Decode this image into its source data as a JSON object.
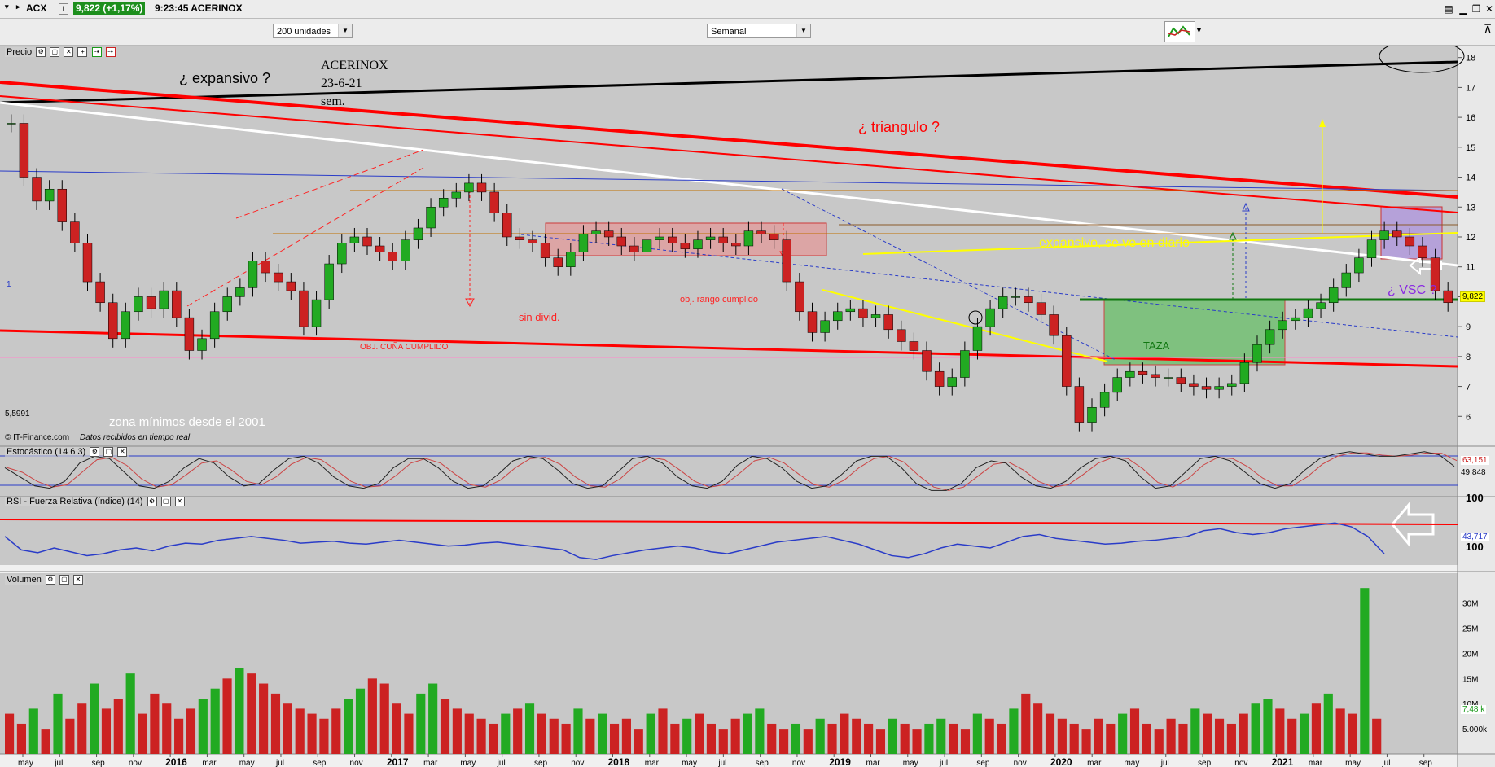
{
  "topbar": {
    "symbol": "ACX",
    "price_change": "9,822 (+1,17%)",
    "time_name": "9:23:45 ACERINOX"
  },
  "toolbar": {
    "units_select": "200 unidades",
    "period_select": "Semanal"
  },
  "panels": {
    "price": "Precio",
    "stochastic": "Estocástico (14 6 3)",
    "rsi": "RSI - Fuerza Relativa (índice) (14)",
    "volume": "Volumen"
  },
  "annotations": {
    "expansivo": "¿ expansivo ?",
    "title1": "ACERINOX",
    "title2": "23-6-21",
    "title3": "sem.",
    "triangulo": "¿ triangulo ?",
    "expansivo_diario": "expansivo, se ve en diario",
    "vsc": "¿ VSC ?",
    "sin_divid": "sin divid.",
    "obj_rango": "obj. rango cumplido",
    "obj_cuna": "OBJ. CUÑA CUMPLIDO",
    "taza": "TAZA",
    "zona_minimos": "zona mínimos desde el 2001",
    "min_label": "5,5991",
    "left_marker": "1",
    "source": "© IT-Finance.com",
    "source_note": "Datos recibidos en tiempo real",
    "price_tag": "9,822",
    "stoch_val1": "63,151",
    "stoch_val2": "49,848",
    "rsi_val": "43,717",
    "vol_val": "7,48 k"
  },
  "colors": {
    "background": "#c8c8c8",
    "up_candle": "#22aa22",
    "down_candle": "#cc2222",
    "red_line": "#ff0000",
    "white_line": "#ffffff",
    "blue_line": "#2a3cc8",
    "yellow_line": "#ffff00",
    "black_line": "#000000",
    "range_box": "#e0a0a0",
    "cup_box": "#6ec06e",
    "vsc_box": "#b39ddb"
  },
  "chart_data": [
    {
      "type": "line",
      "panel": "price",
      "title": "ACERINOX",
      "x_ticks": [
        "may",
        "jul",
        "sep",
        "nov",
        "2016",
        "mar",
        "may",
        "jul",
        "sep",
        "nov",
        "2017",
        "mar",
        "may",
        "jul",
        "sep",
        "nov",
        "2018",
        "mar",
        "may",
        "jul",
        "sep",
        "nov",
        "2019",
        "mar",
        "may",
        "jul",
        "sep",
        "nov",
        "2020",
        "mar",
        "may",
        "jul",
        "sep",
        "nov",
        "2021",
        "mar",
        "may",
        "jul",
        "sep"
      ],
      "y_ticks": [
        6,
        7,
        8,
        9,
        10,
        11,
        12,
        13,
        14,
        15,
        16,
        17,
        18
      ],
      "ylim": [
        5,
        18.4
      ],
      "series": [
        {
          "values": [
            15.8,
            14.0,
            13.2,
            13.6,
            12.5,
            11.8,
            10.5,
            9.8,
            8.6,
            9.5,
            10.0,
            9.6,
            10.2,
            9.3,
            8.2,
            8.6,
            9.5,
            10.0,
            10.3,
            11.2,
            10.8,
            10.5,
            10.2,
            9.0,
            9.9,
            11.1,
            11.8,
            12.0,
            11.7,
            11.5,
            11.2,
            11.9,
            12.3,
            13.0,
            13.3,
            13.5,
            13.8,
            13.5,
            12.8,
            12.0,
            11.9,
            11.8,
            11.3,
            11.0,
            11.5,
            12.1,
            12.2,
            12.0,
            11.7,
            11.5,
            11.9,
            12.0,
            11.8,
            11.6,
            11.9,
            12.0,
            11.8,
            11.7,
            12.2,
            12.1,
            11.9,
            10.5,
            9.5,
            8.8,
            9.2,
            9.5,
            9.6,
            9.3,
            9.4,
            8.9,
            8.5,
            8.2,
            7.5,
            7.0,
            7.3,
            8.2,
            9.0,
            9.6,
            10.0,
            10.0,
            9.8,
            9.4,
            8.7,
            7.0,
            5.8,
            6.3,
            6.8,
            7.3,
            7.5,
            7.4,
            7.3,
            7.3,
            7.1,
            7.0,
            6.9,
            7.0,
            7.1,
            7.8,
            8.4,
            8.9,
            9.2,
            9.3,
            9.6,
            9.8,
            10.3,
            10.8,
            11.3,
            11.9,
            12.2,
            12.0,
            11.7,
            11.3,
            10.2,
            9.8
          ]
        }
      ]
    },
    {
      "type": "line",
      "panel": "stochastic",
      "y_ticks": [
        100
      ],
      "ylim": [
        0,
        100
      ],
      "series": [
        {
          "values": [
            60,
            40,
            20,
            15,
            30,
            70,
            85,
            80,
            50,
            20,
            15,
            30,
            60,
            80,
            70,
            40,
            20,
            25,
            55,
            80,
            85,
            70,
            40,
            20,
            15,
            25,
            60,
            80,
            80,
            60,
            30,
            15,
            20,
            45,
            75,
            85,
            80,
            55,
            25,
            15,
            20,
            50,
            80,
            85,
            70,
            40,
            20,
            15,
            30,
            65,
            85,
            80,
            60,
            30,
            15,
            20,
            45,
            75,
            85,
            85,
            60,
            25,
            10,
            10,
            25,
            60,
            75,
            70,
            40,
            20,
            15,
            30,
            60,
            80,
            85,
            75,
            40,
            15,
            20,
            50,
            80,
            85,
            75,
            50,
            25,
            15,
            25,
            55,
            80,
            90,
            95,
            90,
            85,
            85,
            90,
            95,
            88,
            63
          ]
        }
      ]
    },
    {
      "type": "line",
      "panel": "rsi",
      "y_ticks": [
        100
      ],
      "ylim": [
        0,
        100
      ],
      "series": [
        {
          "values": [
            62,
            48,
            45,
            50,
            46,
            42,
            44,
            48,
            50,
            47,
            52,
            55,
            54,
            58,
            60,
            62,
            60,
            58,
            55,
            56,
            57,
            55,
            54,
            56,
            58,
            56,
            54,
            52,
            53,
            55,
            56,
            54,
            52,
            50,
            48,
            40,
            38,
            42,
            45,
            48,
            50,
            52,
            50,
            46,
            44,
            48,
            52,
            56,
            58,
            60,
            62,
            58,
            54,
            48,
            42,
            40,
            44,
            50,
            54,
            52,
            50,
            56,
            62,
            64,
            60,
            58,
            56,
            54,
            55,
            57,
            58,
            60,
            62,
            68,
            70,
            66,
            64,
            66,
            70,
            72,
            74,
            76,
            72,
            62,
            44
          ]
        }
      ]
    },
    {
      "type": "bar",
      "panel": "volume",
      "y_ticks": [
        "5.000k",
        "10M",
        "15M",
        "20M",
        "25M",
        "30M"
      ],
      "ylim": [
        0,
        34
      ],
      "values": [
        8,
        6,
        9,
        5,
        12,
        7,
        10,
        14,
        9,
        11,
        16,
        8,
        12,
        10,
        7,
        9,
        11,
        13,
        15,
        17,
        16,
        14,
        12,
        10,
        9,
        8,
        7,
        9,
        11,
        13,
        15,
        14,
        10,
        8,
        12,
        14,
        11,
        9,
        8,
        7,
        6,
        8,
        9,
        10,
        8,
        7,
        6,
        9,
        7,
        8,
        6,
        7,
        5,
        8,
        9,
        6,
        7,
        8,
        6,
        5,
        7,
        8,
        9,
        6,
        5,
        6,
        5,
        7,
        6,
        8,
        7,
        6,
        5,
        7,
        6,
        5,
        6,
        7,
        6,
        5,
        8,
        7,
        6,
        9,
        12,
        10,
        8,
        7,
        6,
        5,
        7,
        6,
        8,
        9,
        6,
        5,
        7,
        6,
        9,
        8,
        7,
        6,
        8,
        10,
        11,
        9,
        7,
        8,
        10,
        12,
        9,
        8,
        33,
        7
      ]
    }
  ]
}
